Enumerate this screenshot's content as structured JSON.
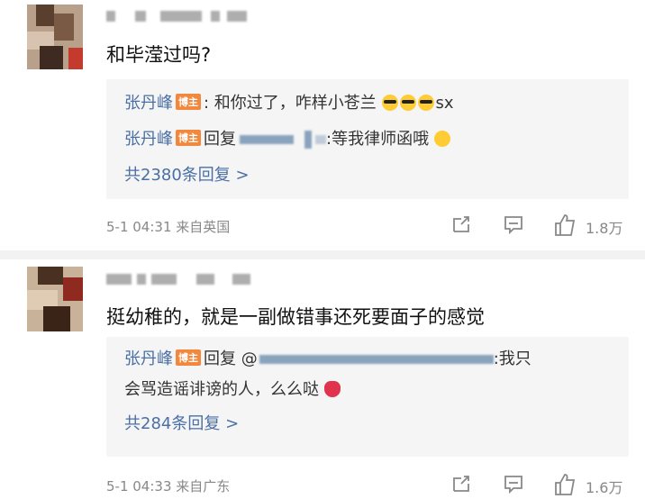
{
  "comments": [
    {
      "text": "和毕滢过吗?",
      "replies": [
        {
          "name": "张丹峰",
          "badge": "博主",
          "segments": [
            ": 和你过了，咋样小苍兰",
            "sx"
          ]
        },
        {
          "name": "张丹峰",
          "badge": "博主",
          "segments": [
            "回复",
            ":等我律师函哦"
          ]
        }
      ],
      "more_replies": "共2380条回复 >",
      "timestamp": "5-1 04:31 来自英国",
      "likes": "1.8万"
    },
    {
      "text": "挺幼稚的，就是一副做错事还死要面子的感觉",
      "replies": [
        {
          "name": "张丹峰",
          "badge": "博主",
          "segments": [
            "回复 @",
            ":我只",
            "会骂造谣诽谤的人，么么哒"
          ]
        }
      ],
      "more_replies": "共284条回复 >",
      "timestamp": "5-1 04:33 来自广东",
      "likes": "1.6万"
    }
  ],
  "colors": {
    "link": "#4a6fa5",
    "badge": "#f2883e",
    "meta": "#888888",
    "reply_bg": "#f5f5f5"
  },
  "icons": [
    "share-icon",
    "comment-icon",
    "like-icon",
    "sunglasses-emoji",
    "laugh-emoji",
    "kiss-emoji"
  ]
}
